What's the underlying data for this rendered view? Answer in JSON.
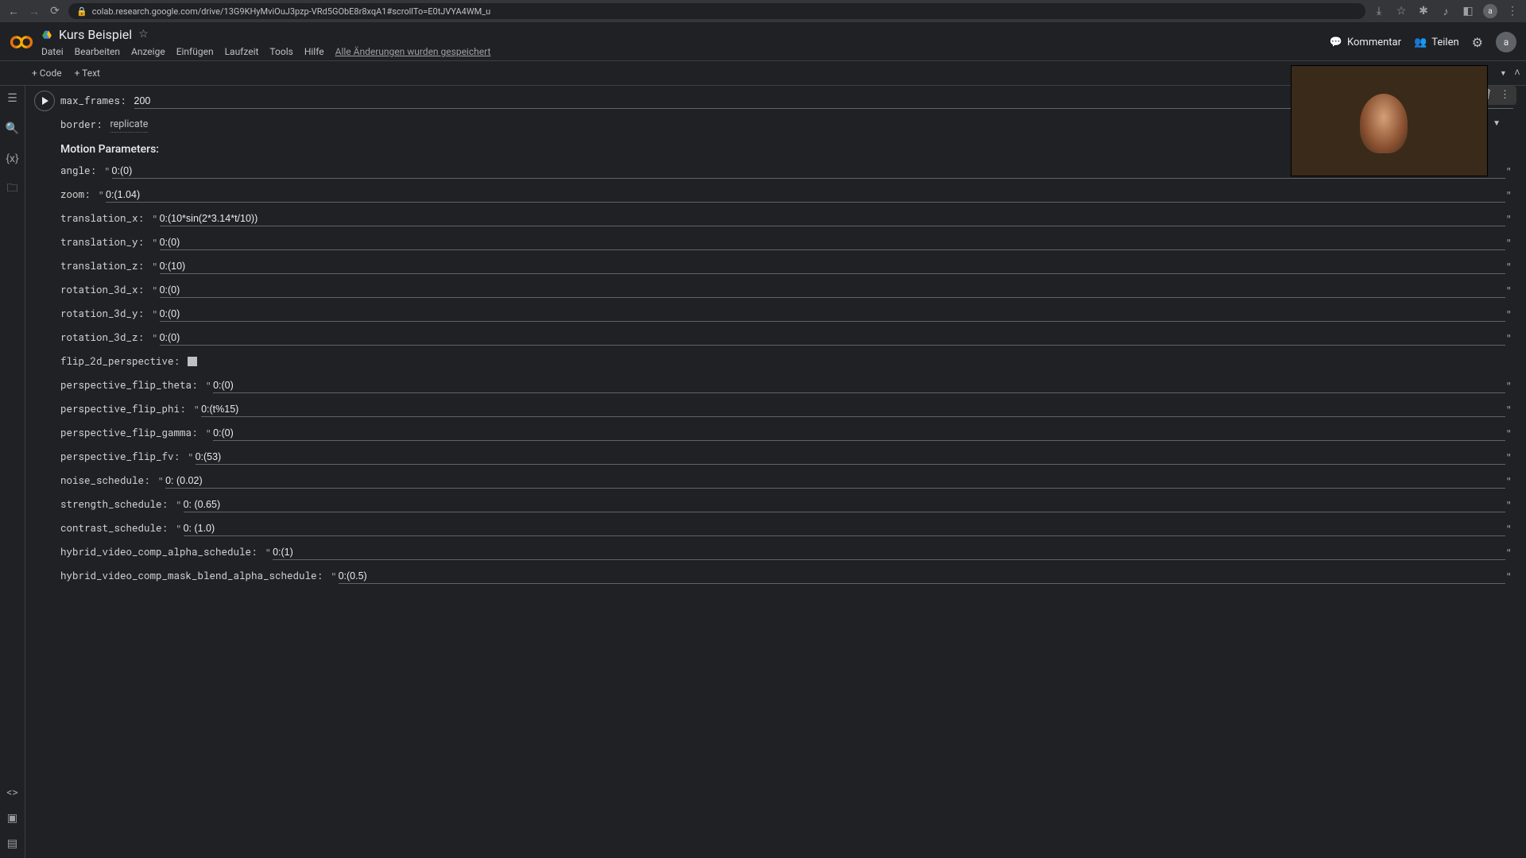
{
  "browser": {
    "url": "colab.research.google.com/drive/13G9KHyMviOuJ3pzp-VRd5GObE8r8xqA1#scrollTo=E0tJVYA4WM_u",
    "avatar": "a"
  },
  "header": {
    "title": "Kurs Beispiel",
    "menu": [
      "Datei",
      "Bearbeiten",
      "Anzeige",
      "Einfügen",
      "Laufzeit",
      "Tools",
      "Hilfe"
    ],
    "saved": "Alle Änderungen wurden gespeichert",
    "comment": "Kommentar",
    "share": "Teilen",
    "avatar": "a"
  },
  "toolbar": {
    "code": "+ Code",
    "text": "+ Text"
  },
  "form": {
    "max_frames": {
      "label": "max_frames:",
      "value": "200"
    },
    "border": {
      "label": "border:",
      "value": "replicate"
    },
    "section_motion": "Motion Parameters:",
    "angle": {
      "label": "angle:",
      "value": "0:(0)"
    },
    "zoom": {
      "label": "zoom:",
      "value": "0:(1.04)"
    },
    "translation_x": {
      "label": "translation_x:",
      "value": "0:(10*sin(2*3.14*t/10))"
    },
    "translation_y": {
      "label": "translation_y:",
      "value": "0:(0)"
    },
    "translation_z": {
      "label": "translation_z:",
      "value": "0:(10)"
    },
    "rotation_3d_x": {
      "label": "rotation_3d_x:",
      "value": "0:(0)"
    },
    "rotation_3d_y": {
      "label": "rotation_3d_y:",
      "value": "0:(0)"
    },
    "rotation_3d_z": {
      "label": "rotation_3d_z:",
      "value": "0:(0)"
    },
    "flip_2d_perspective": {
      "label": "flip_2d_perspective:",
      "value": false
    },
    "perspective_flip_theta": {
      "label": "perspective_flip_theta:",
      "value": "0:(0)"
    },
    "perspective_flip_phi": {
      "label": "perspective_flip_phi:",
      "value": "0:(t%15)"
    },
    "perspective_flip_gamma": {
      "label": "perspective_flip_gamma:",
      "value": "0:(0)"
    },
    "perspective_flip_fv": {
      "label": "perspective_flip_fv:",
      "value": "0:(53)"
    },
    "noise_schedule": {
      "label": "noise_schedule:",
      "value": "0: (0.02)"
    },
    "strength_schedule": {
      "label": "strength_schedule:",
      "value": "0: (0.65)"
    },
    "contrast_schedule": {
      "label": "contrast_schedule:",
      "value": "0: (1.0)"
    },
    "hybrid_video_comp_alpha_schedule": {
      "label": "hybrid_video_comp_alpha_schedule:",
      "value": "0:(1)"
    },
    "hybrid_video_comp_mask_blend_alpha_schedule": {
      "label": "hybrid_video_comp_mask_blend_alpha_schedule:",
      "value": "0:(0.5)"
    }
  }
}
